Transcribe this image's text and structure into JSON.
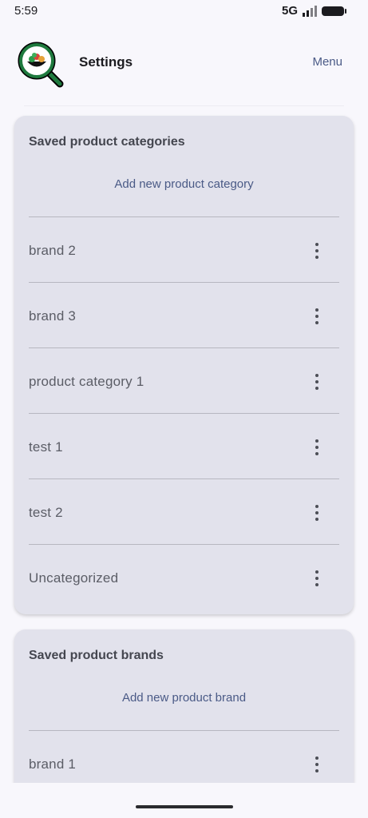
{
  "status": {
    "time": "5:59",
    "network": "5G"
  },
  "app_bar": {
    "title": "Settings",
    "menu_label": "Menu",
    "logo_icon": "magnifier-salad-icon"
  },
  "categories_card": {
    "title": "Saved product categories",
    "add_label": "Add new product category",
    "items": [
      {
        "label": "brand 2"
      },
      {
        "label": "brand 3"
      },
      {
        "label": "product category 1"
      },
      {
        "label": "test 1"
      },
      {
        "label": "test 2"
      },
      {
        "label": "Uncategorized"
      }
    ]
  },
  "brands_card": {
    "title": "Saved product brands",
    "add_label": "Add new product brand",
    "items": [
      {
        "label": "brand 1"
      }
    ]
  },
  "colors": {
    "accent": "#4a5a86",
    "card_bg": "#e2e2ec",
    "page_bg": "#f8f7fc",
    "logo_ring": "#1f7a3e"
  }
}
